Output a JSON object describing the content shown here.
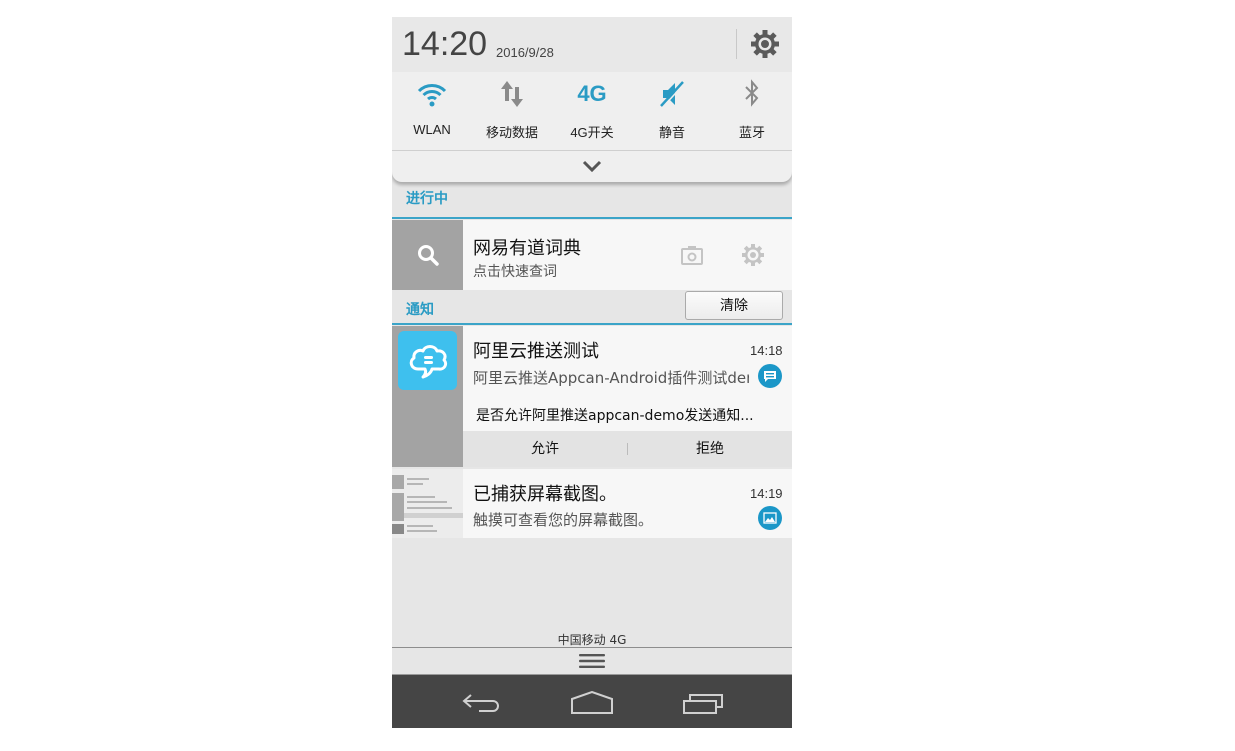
{
  "header": {
    "time": "14:20",
    "date": "2016/9/28",
    "settings_icon": "gear-icon"
  },
  "quick_settings": {
    "items": [
      {
        "label": "WLAN",
        "icon": "wifi-icon",
        "active": true
      },
      {
        "label": "移动数据",
        "icon": "mobile-data-icon",
        "active": false
      },
      {
        "label": "4G开关",
        "icon": "4g-icon",
        "icon_text": "4G",
        "active": true
      },
      {
        "label": "静音",
        "icon": "mute-icon",
        "active": true
      },
      {
        "label": "蓝牙",
        "icon": "bluetooth-icon",
        "active": false
      }
    ],
    "expand_icon": "chevron-down-icon"
  },
  "colors": {
    "accent": "#2a9bc4",
    "panel_bg": "#e6e6e6",
    "nav_bg": "#454545",
    "app_icon_bg": "#3ec0ee",
    "badge": "#1b97c8"
  },
  "ongoing": {
    "title": "进行中",
    "item": {
      "title": "网易有道词典",
      "subtitle": "点击快速查词",
      "left_icon": "search-icon",
      "actions": [
        "camera-icon",
        "gear-icon"
      ]
    }
  },
  "notifications": {
    "title": "通知",
    "clear_label": "清除",
    "items": [
      {
        "title": "阿里云推送测试",
        "subtitle": "阿里云推送Appcan-Android插件测试dem",
        "time": "14:18",
        "body": "是否允许阿里推送appcan-demo发送通知...",
        "badge_icon": "message-icon",
        "actions": [
          "允许",
          "拒绝"
        ]
      },
      {
        "title": "已捕获屏幕截图。",
        "subtitle": "触摸可查看您的屏幕截图。",
        "time": "14:19",
        "badge_icon": "image-icon"
      }
    ]
  },
  "footer": {
    "carrier": "中国移动 4G",
    "handle_icon": "menu-icon",
    "nav": [
      "back-icon",
      "home-icon",
      "recents-icon"
    ]
  }
}
